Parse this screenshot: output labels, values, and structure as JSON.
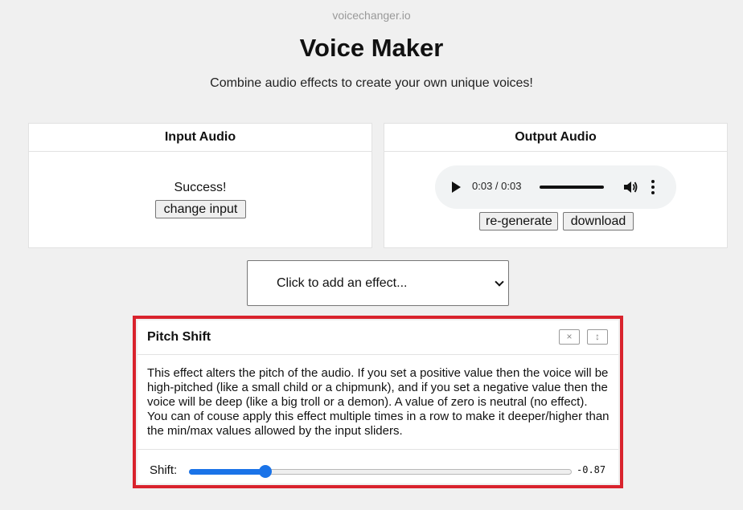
{
  "site_name": "voicechanger.io",
  "title": "Voice Maker",
  "subtitle": "Combine audio effects to create your own unique voices!",
  "input_panel": {
    "header": "Input Audio",
    "status": "Success!",
    "change_button": "change input"
  },
  "output_panel": {
    "header": "Output Audio",
    "player": {
      "time": "0:03 / 0:03",
      "progress": 1.0
    },
    "regenerate_button": "re-generate",
    "download_button": "download"
  },
  "effect_select": {
    "selected": "Click to add an effect..."
  },
  "effect_card": {
    "title": "Pitch Shift",
    "close_icon": "×",
    "move_icon": "↕",
    "description": "This effect alters the pitch of the audio. If you set a positive value then the voice will be high-pitched (like a small child or a chipmunk), and if you set a negative value then the voice will be deep (like a big troll or a demon). A value of zero is neutral (no effect). You can of couse apply this effect multiple times in a row to make it deeper/higher than the min/max values allowed by the input sliders.",
    "slider_label": "Shift:",
    "slider_value": "-0.87",
    "slider_fraction": 0.2
  },
  "colors": {
    "highlight": "#d9232d",
    "accent": "#1a73e8"
  }
}
